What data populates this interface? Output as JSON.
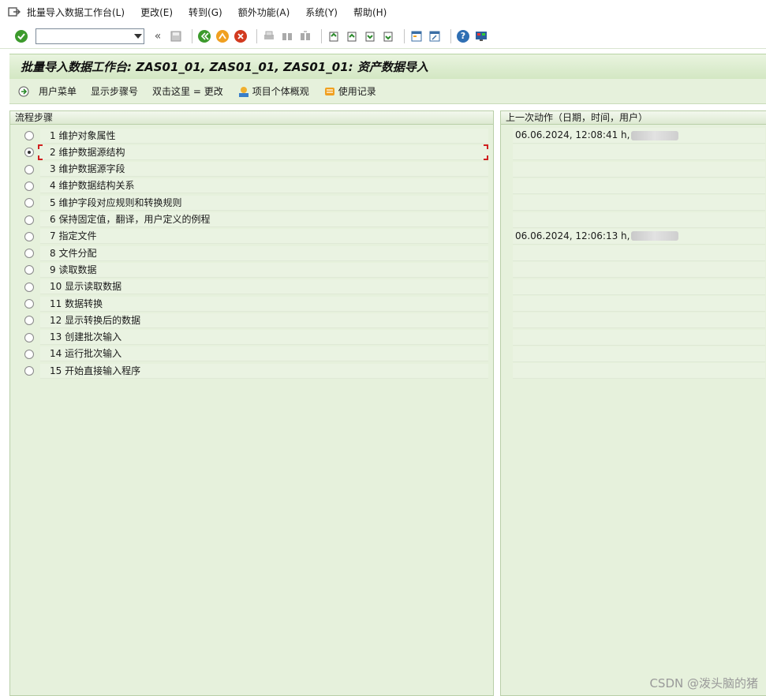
{
  "menu": {
    "items": [
      "批量导入数据工作台(L)",
      "更改(E)",
      "转到(G)",
      "额外功能(A)",
      "系统(Y)",
      "帮助(H)"
    ]
  },
  "toolbar": {
    "command_field_value": "",
    "icons": [
      "enter-icon",
      "save-icon",
      "back-icon",
      "exit-icon",
      "cancel-icon",
      "print-icon",
      "find-icon",
      "find-next-icon",
      "first-page-icon",
      "prev-page-icon",
      "next-page-icon",
      "last-page-icon",
      "new-session-icon",
      "shortcut-icon",
      "help-icon",
      "layout-icon"
    ]
  },
  "title": "批量导入数据工作台: ZAS01_01, ZAS01_01, ZAS01_01: 资产数据导入",
  "app_toolbar": {
    "user_menu": "用户菜单",
    "show_step_numbers": "显示步骤号",
    "double_click_hint": "双击这里 = 更改",
    "item_overview": "项目个体概观",
    "usage_log": "使用记录"
  },
  "steps_panel": {
    "header": "流程步骤",
    "selected_index": 1,
    "steps": [
      "1 维护对象属性",
      "2 维护数据源结构",
      "3 维护数据源字段",
      "4 维护数据结构关系",
      "5 维护字段对应规则和转换规则",
      "6 保持固定值，翻译，用户定义的例程",
      "7 指定文件",
      "8 文件分配",
      "9 读取数据",
      "10 显示读取数据",
      "11 数据转换",
      "12 显示转换后的数据",
      "13 创建批次输入",
      "14 运行批次输入",
      "15 开始直接输入程序"
    ]
  },
  "actions_panel": {
    "header": "上一次动作（日期，时间，用户）",
    "entries": [
      {
        "row": 0,
        "text": "06.06.2024, 12:08:41 h,"
      },
      {
        "row": 6,
        "text": "06.06.2024, 12:06:13 h,"
      }
    ]
  },
  "watermark": "CSDN @泼头脑的猪"
}
